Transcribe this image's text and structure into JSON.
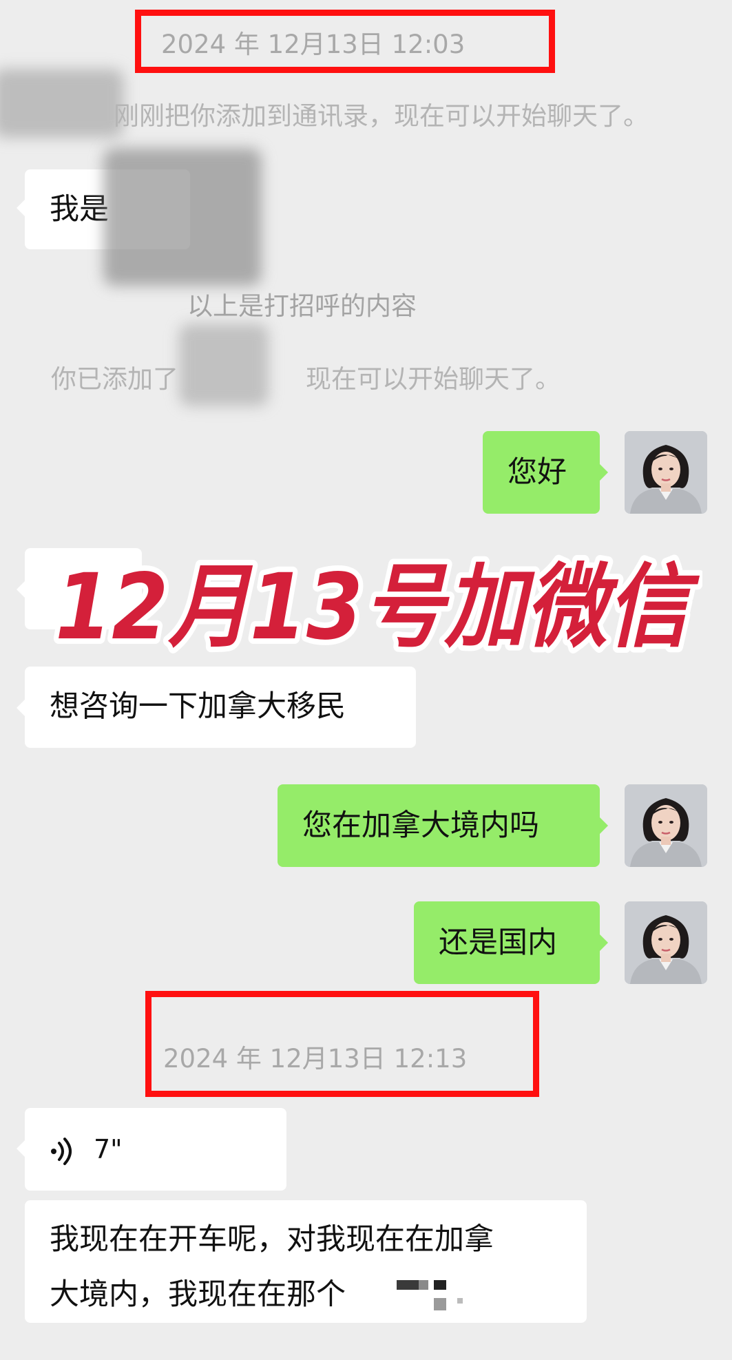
{
  "timestamps": [
    "2024 年 12月13日 12:03",
    "2024 年 12月13日 12:13"
  ],
  "system": {
    "added_notice": "刚刚把你添加到通讯录，现在可以开始聊天了。",
    "greeting_label": "以上是打招呼的内容",
    "you_added_prefix": "你已添加了",
    "you_added_suffix": "现在可以开始聊天了。"
  },
  "messages": {
    "greeting": "我是",
    "hello": "您好",
    "consult": "想咨询一下加拿大移民",
    "in_canada_q": "您在加拿大境内吗",
    "or_domestic": "还是国内",
    "voice_duration": "7\"",
    "driving_line1": "我现在在开车呢，对我现在在加拿",
    "driving_line2": "大境内，我现在在那个"
  },
  "overlay_title": "12月13号加微信",
  "colors": {
    "background": "#ededed",
    "outgoing_bubble": "#95ec69",
    "incoming_bubble": "#ffffff",
    "highlight_box": "#ff1010",
    "overlay_text": "#d4203a"
  },
  "icons": {
    "voice": "voice-wave-icon"
  }
}
